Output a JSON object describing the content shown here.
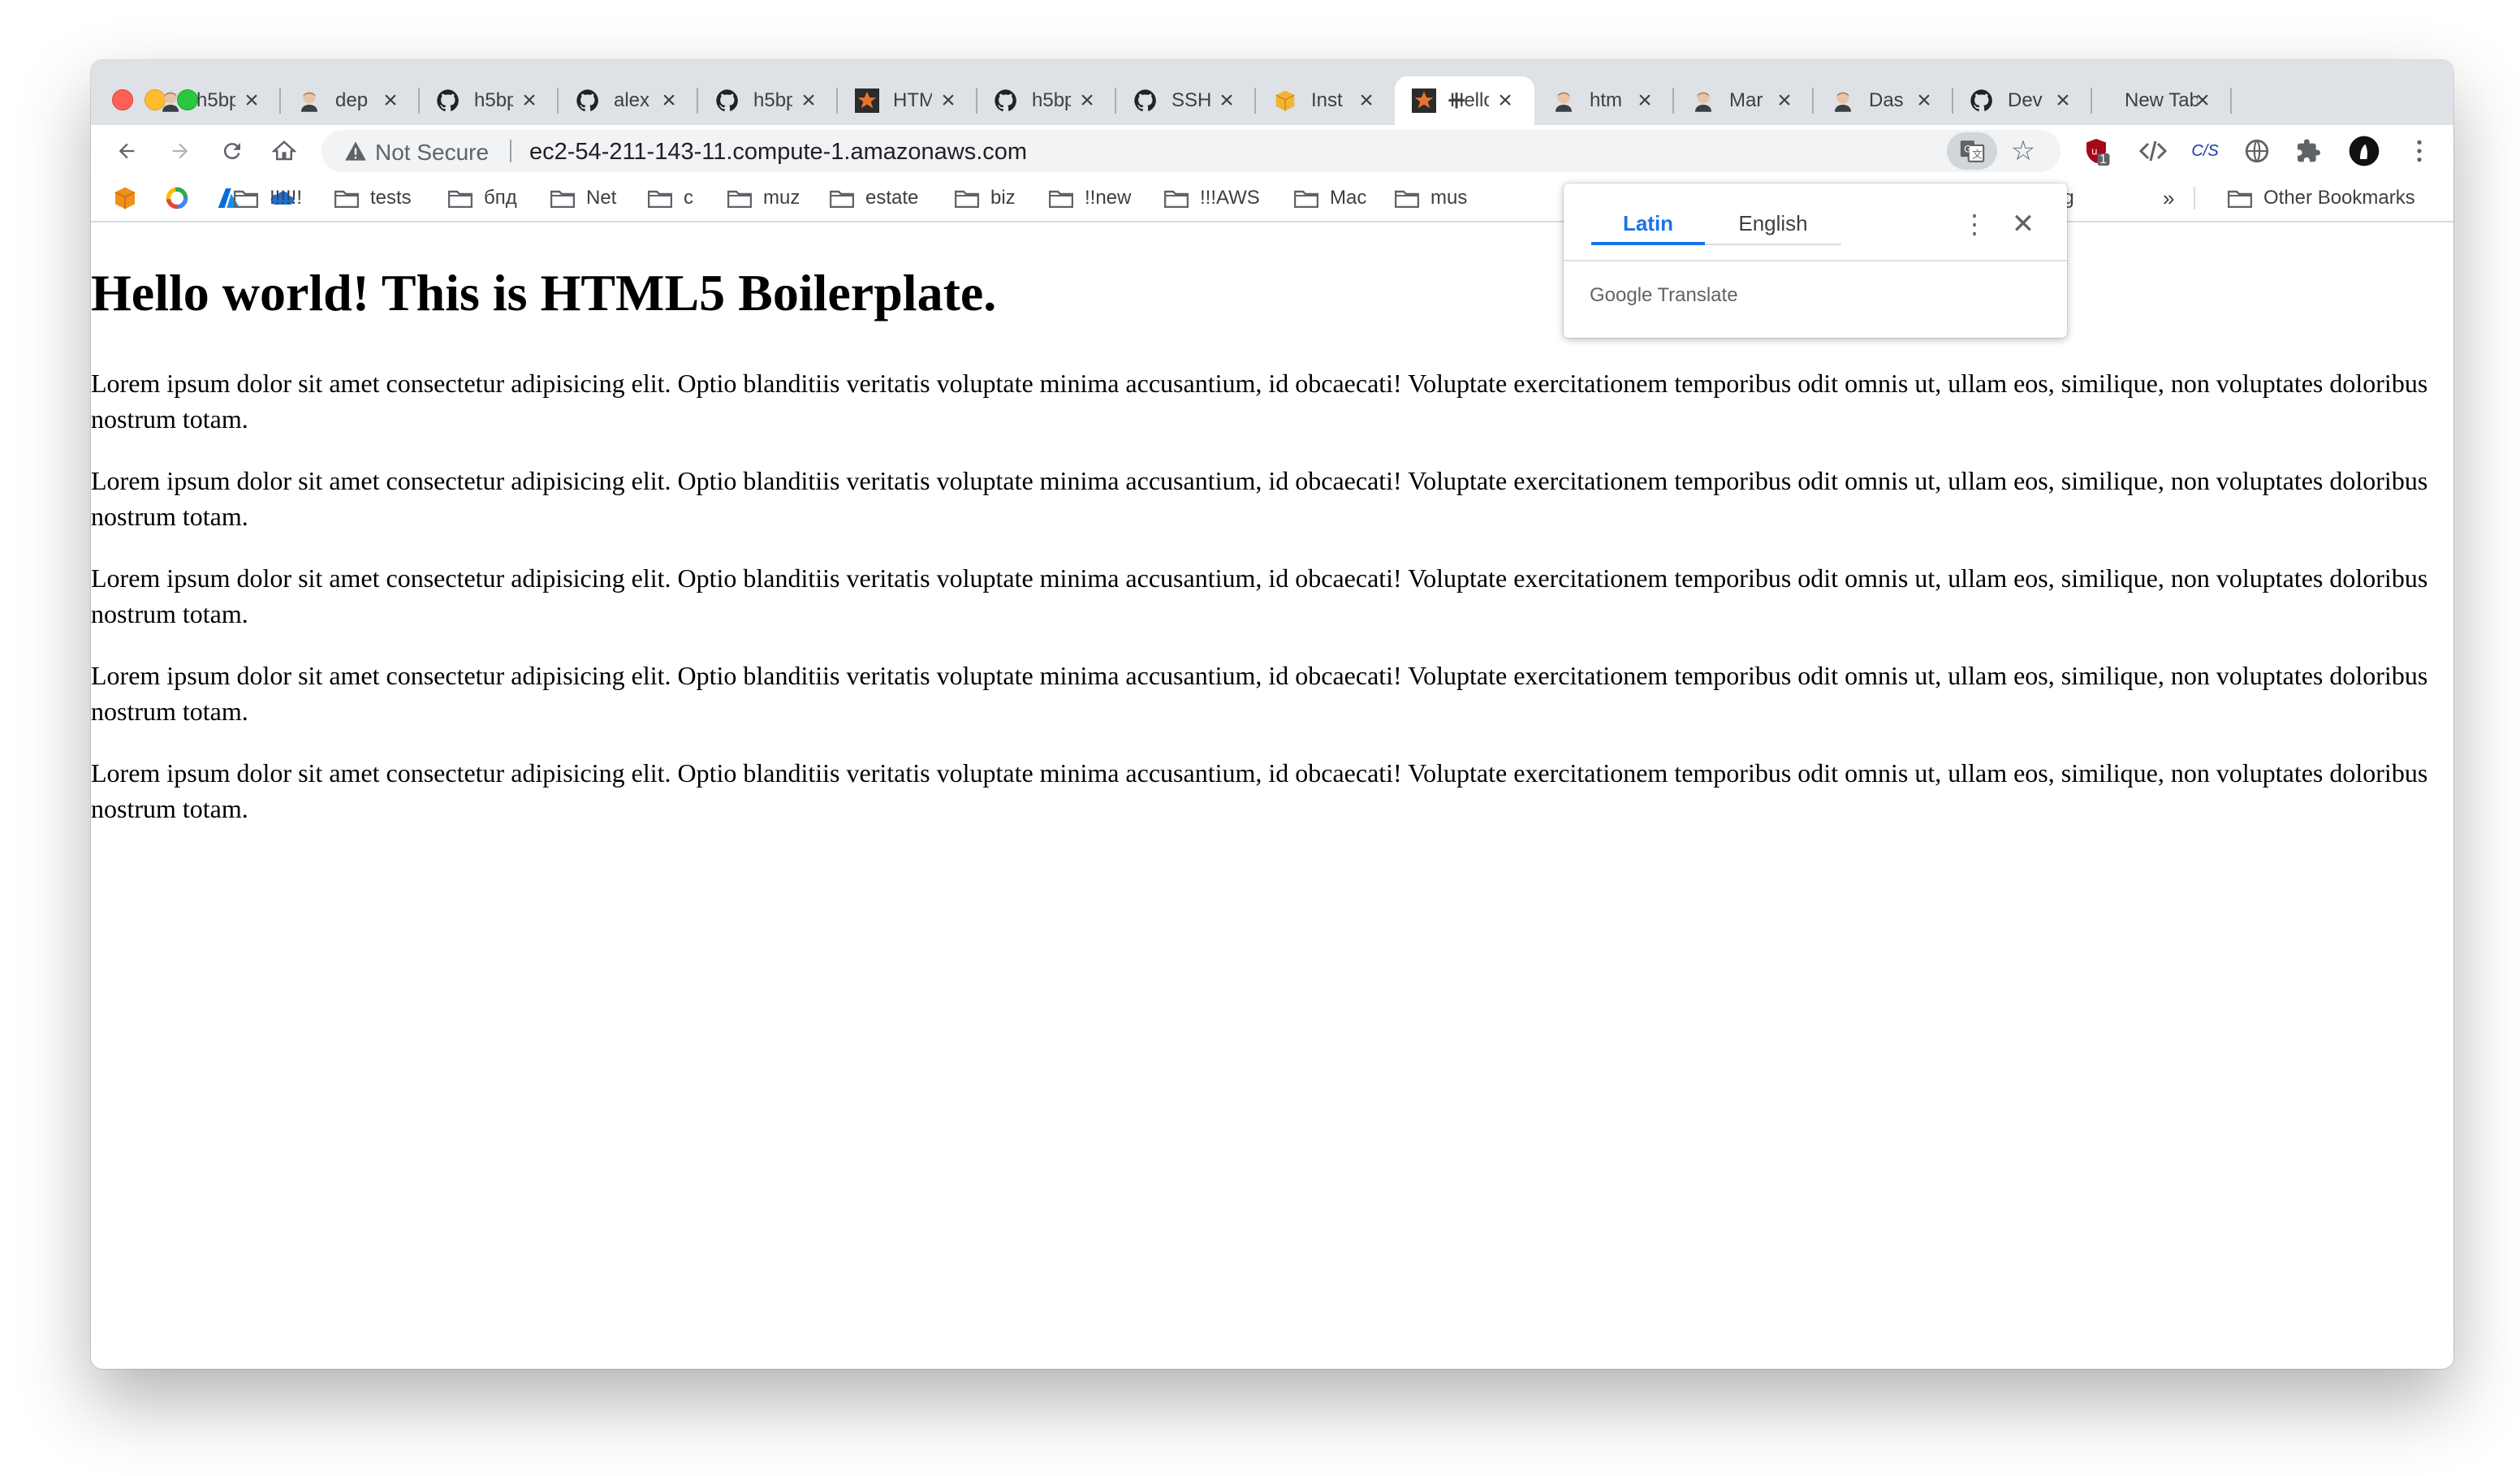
{
  "tabs": [
    {
      "title": "h5bp",
      "favicon": "avatar-icon"
    },
    {
      "title": "dep",
      "favicon": "avatar-icon"
    },
    {
      "title": "h5bp",
      "favicon": "github-icon"
    },
    {
      "title": "alex",
      "favicon": "github-icon"
    },
    {
      "title": "h5bp",
      "favicon": "github-icon"
    },
    {
      "title": "HTML",
      "favicon": "star-icon"
    },
    {
      "title": "h5bp",
      "favicon": "github-icon"
    },
    {
      "title": "SSH",
      "favicon": "github-icon"
    },
    {
      "title": "Inst",
      "favicon": "box-icon"
    },
    {
      "title": "Hello",
      "favicon": "star-icon"
    },
    {
      "title": "htm",
      "favicon": "avatar-icon"
    },
    {
      "title": "Mar",
      "favicon": "avatar-icon"
    },
    {
      "title": "Das",
      "favicon": "avatar-icon"
    },
    {
      "title": "Dev",
      "favicon": "github-icon"
    },
    {
      "title": "New Tab",
      "favicon": ""
    }
  ],
  "toolbar": {
    "security_text": "Not Secure",
    "url": "ec2-54-211-143-11.compute-1.amazonaws.com",
    "extension_badge": "1",
    "css_extension_label": "C/S"
  },
  "bookmarks": {
    "items": [
      "!!!!!!",
      "tests",
      "бпд",
      "Net",
      "c",
      "muz",
      "estate",
      "biz",
      "!!new",
      "!!!AWS",
      "Mac",
      "mus"
    ],
    "trailing_item": "bg",
    "overflow_label": "»",
    "other": "Other Bookmarks"
  },
  "page": {
    "heading": "Hello world! This is HTML5 Boilerplate.",
    "paragraphs": [
      "Lorem ipsum dolor sit amet consectetur adipisicing elit. Optio blanditiis veritatis voluptate minima accusantium, id obcaecati! Voluptate exercitationem temporibus odit omnis ut, ullam eos, similique, non voluptates doloribus nostrum totam.",
      "Lorem ipsum dolor sit amet consectetur adipisicing elit. Optio blanditiis veritatis voluptate minima accusantium, id obcaecati! Voluptate exercitationem temporibus odit omnis ut, ullam eos, similique, non voluptates doloribus nostrum totam.",
      "Lorem ipsum dolor sit amet consectetur adipisicing elit. Optio blanditiis veritatis voluptate minima accusantium, id obcaecati! Voluptate exercitationem temporibus odit omnis ut, ullam eos, similique, non voluptates doloribus nostrum totam.",
      "Lorem ipsum dolor sit amet consectetur adipisicing elit. Optio blanditiis veritatis voluptate minima accusantium, id obcaecati! Voluptate exercitationem temporibus odit omnis ut, ullam eos, similique, non voluptates doloribus nostrum totam.",
      "Lorem ipsum dolor sit amet consectetur adipisicing elit. Optio blanditiis veritatis voluptate minima accusantium, id obcaecati! Voluptate exercitationem temporibus odit omnis ut, ullam eos, similique, non voluptates doloribus nostrum totam."
    ]
  },
  "translate_popup": {
    "source_language": "Latin",
    "target_language": "English",
    "brand_google": "Google",
    "brand_translate": "Translate"
  },
  "colors": {
    "accent": "#1a73e8",
    "tabstrip": "#dee1e6",
    "omnibox": "#f1f3f4"
  }
}
